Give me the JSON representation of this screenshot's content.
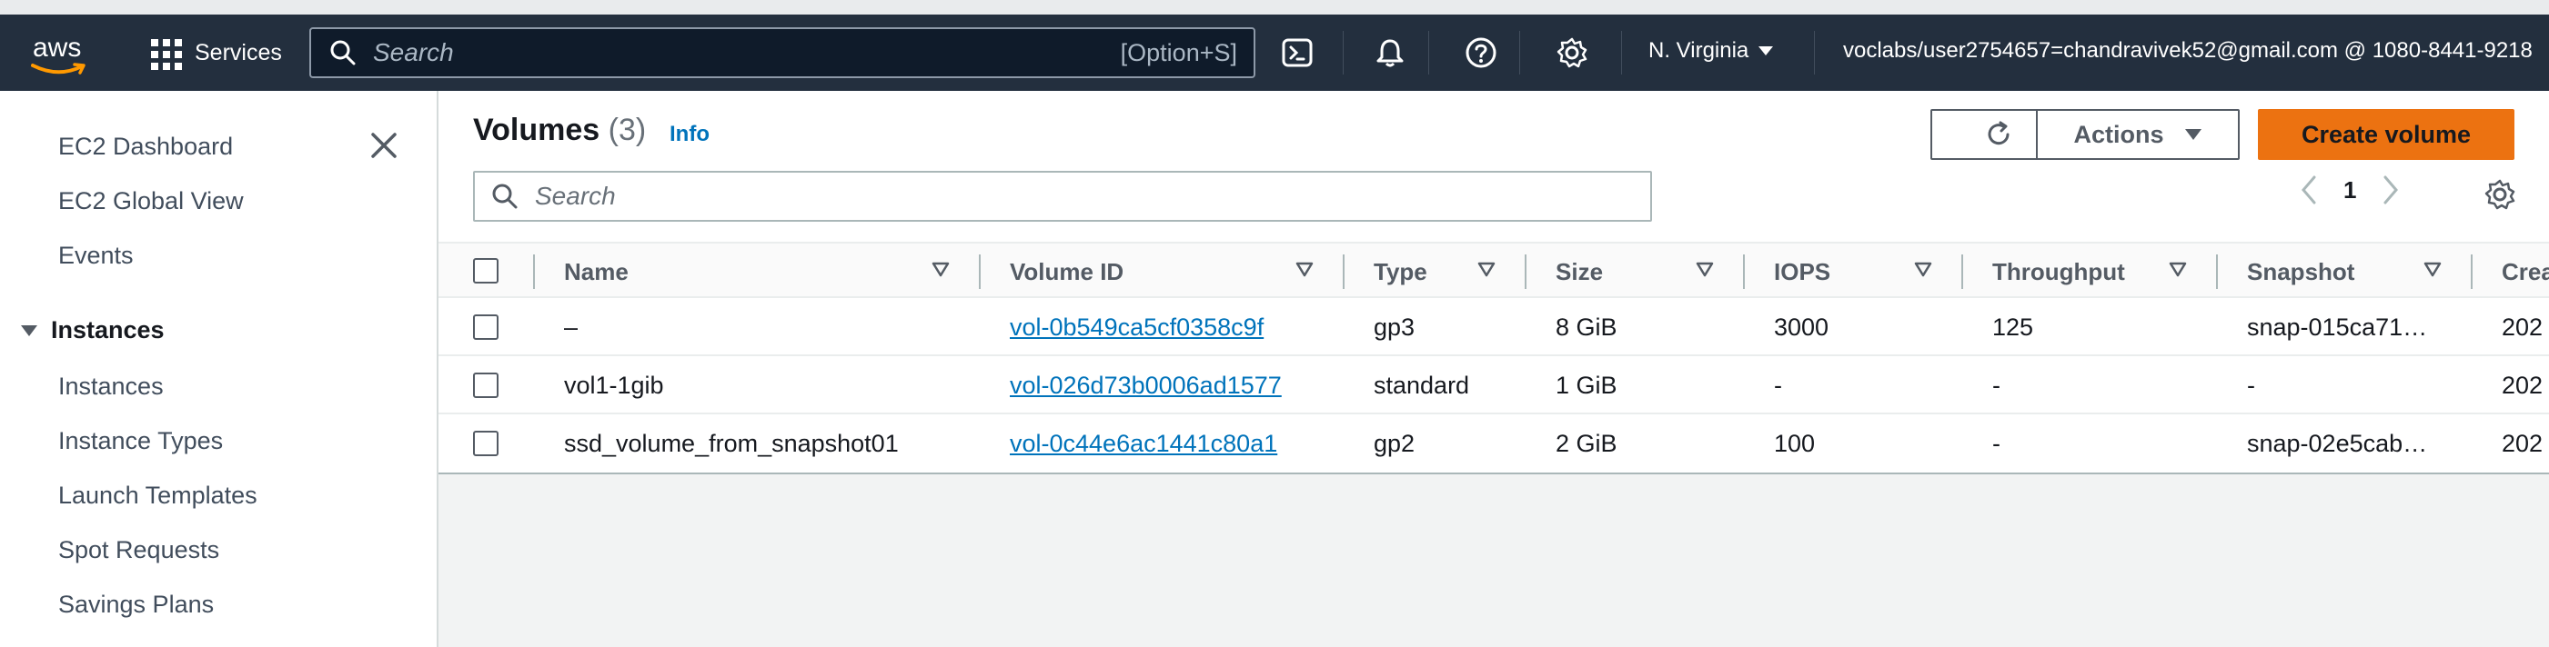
{
  "topbar": {
    "logo": "aws",
    "services_label": "Services",
    "search_placeholder": "Search",
    "search_shortcut": "[Option+S]",
    "region": "N. Virginia",
    "account": "voclabs/user2754657=chandravivek52@gmail.com @ 1080-8441-9218",
    "icons": [
      "cloudshell-icon",
      "bell-icon",
      "help-icon",
      "gear-icon"
    ]
  },
  "sidebar": {
    "items_top": [
      "EC2 Dashboard",
      "EC2 Global View",
      "Events"
    ],
    "section": "Instances",
    "items": [
      "Instances",
      "Instance Types",
      "Launch Templates",
      "Spot Requests",
      "Savings Plans"
    ]
  },
  "main": {
    "title": "Volumes",
    "count": "(3)",
    "info": "Info",
    "actions_label": "Actions",
    "create_label": "Create volume",
    "search_placeholder": "Search",
    "page": "1",
    "columns": [
      "Name",
      "Volume ID",
      "Type",
      "Size",
      "IOPS",
      "Throughput",
      "Snapshot",
      "Created"
    ],
    "rows": [
      {
        "name": "–",
        "volume_id": "vol-0b549ca5cf0358c9f",
        "type": "gp3",
        "size": "8 GiB",
        "iops": "3000",
        "throughput": "125",
        "snapshot": "snap-015ca71…",
        "created": "202"
      },
      {
        "name": "vol1-1gib",
        "volume_id": "vol-026d73b0006ad1577",
        "type": "standard",
        "size": "1 GiB",
        "iops": "-",
        "throughput": "-",
        "snapshot": "-",
        "created": "202"
      },
      {
        "name": "ssd_volume_from_snapshot01",
        "volume_id": "vol-0c44e6ac1441c80a1",
        "type": "gp2",
        "size": "2 GiB",
        "iops": "100",
        "throughput": "-",
        "snapshot": "snap-02e5cab…",
        "created": "202"
      }
    ]
  },
  "colors": {
    "topbar": "#232f3e",
    "primary": "#ec7211",
    "link": "#0073bb"
  }
}
